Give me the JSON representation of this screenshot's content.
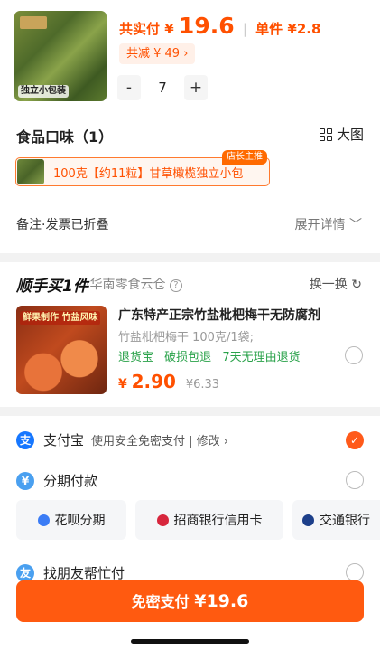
{
  "product1": {
    "thumb_label": "独立小包装",
    "total_label": "共实付",
    "currency": "¥",
    "total_price": "19.6",
    "unit_label": "单件",
    "unit_price": "¥2.8",
    "discount": "共减 ¥ 49 ›",
    "qty_minus": "-",
    "qty": "7",
    "qty_plus": "+"
  },
  "flavor": {
    "title": "食品口味（1）",
    "big_view": "大图",
    "selected": "100克【约11粒】甘草橄榄独立小包",
    "badge": "店长主推"
  },
  "remark": {
    "label": "备注·发票已折叠",
    "expand": "展开详情 ﹀"
  },
  "addon": {
    "brand": "顺手买1件",
    "warehouse": "·华南零食云仓",
    "help": "?",
    "swap": "换一换 ↻",
    "thumb_tag": "鲜果制作 竹盐风味",
    "name": "广东特产正宗竹盐枇杷梅干无防腐剂",
    "spec": "竹盐枇杷梅干 100克/1袋;",
    "services": [
      "退货宝",
      "破损包退",
      "7天无理由退货"
    ],
    "currency": "¥",
    "price": "2.90",
    "old_price": "¥6.33"
  },
  "payment": {
    "alipay": "支付宝",
    "alipay_sub": "使用安全免密支付 | 修改 ›",
    "installment": "分期付款",
    "options": [
      "花呗分期",
      "招商银行信用卡",
      "交通银行"
    ],
    "friend": "找朋友帮忙付",
    "button_label": "免密支付",
    "button_amount": "¥19.6"
  },
  "colors": {
    "accent": "#ff5000",
    "green": "#2aa24a",
    "alipay_blue": "#1677ff"
  }
}
